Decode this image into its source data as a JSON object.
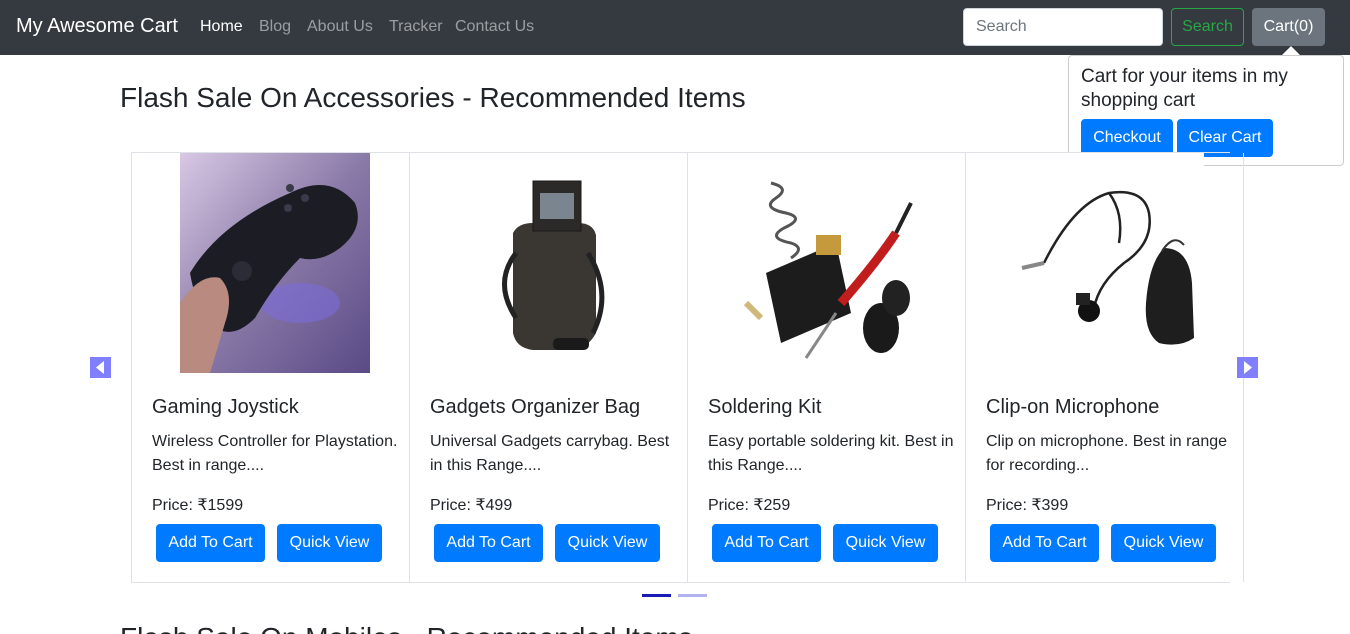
{
  "navbar": {
    "brand": "My Awesome Cart",
    "links": [
      "Home",
      "Blog",
      "About Us",
      "Tracker",
      "Contact Us"
    ],
    "search_placeholder": "Search",
    "search_button": "Search",
    "cart_button": "Cart(0)"
  },
  "popover": {
    "text": "Cart for your items in my shopping cart",
    "checkout": "Checkout",
    "clear": "Clear Cart"
  },
  "section": {
    "title": "Flash Sale On Accessories - Recommended Items",
    "next_title": "Flash Sale On Mobiles - Recommended Items"
  },
  "products": [
    {
      "title": "Gaming Joystick",
      "desc": "Wireless Controller for Playstation. Best in range....",
      "price": "Price: ₹1599",
      "add": "Add To Cart",
      "quick": "Quick View"
    },
    {
      "title": "Gadgets Organizer Bag",
      "desc": "Universal Gadgets carrybag. Best in this Range....",
      "price": "Price: ₹499",
      "add": "Add To Cart",
      "quick": "Quick View"
    },
    {
      "title": "Soldering Kit",
      "desc": "Easy portable soldering kit. Best in this Range....",
      "price": "Price: ₹259",
      "add": "Add To Cart",
      "quick": "Quick View"
    },
    {
      "title": "Clip-on Microphone",
      "desc": "Clip on microphone. Best in range for recording...",
      "price": "Price: ₹399",
      "add": "Add To Cart",
      "quick": "Quick View"
    }
  ],
  "colors": {
    "navbar": "#343a40",
    "primary": "#007bff",
    "success": "#28a745",
    "secondary": "#6c757d",
    "carousel_control": "#7f7fff",
    "indicator_active": "#1a1ab5",
    "indicator_inactive": "#b3b3f0"
  }
}
